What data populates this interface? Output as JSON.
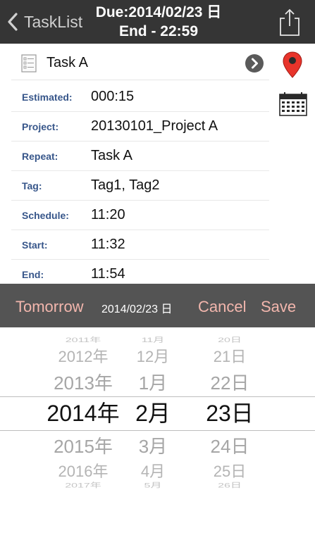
{
  "navbar": {
    "back_label": "TaskList",
    "title_line1": "Due:2014/02/23 日",
    "title_line2": "End - 22:59"
  },
  "task": {
    "name": "Task A"
  },
  "fields": [
    {
      "label": "Estimated:",
      "value": "000:15"
    },
    {
      "label": "Project:",
      "value": "20130101_Project A"
    },
    {
      "label": "Repeat:",
      "value": "Task A"
    },
    {
      "label": "Tag:",
      "value": "Tag1, Tag2"
    },
    {
      "label": "Schedule:",
      "value": "11:20"
    },
    {
      "label": "Start:",
      "value": "11:32"
    },
    {
      "label": "End:",
      "value": "11:54"
    }
  ],
  "toolbar": {
    "tomorrow_label": "Tomorrow",
    "date_label": "2014/02/23 日",
    "cancel_label": "Cancel",
    "save_label": "Save"
  },
  "picker": {
    "years": [
      "2011年",
      "2012年",
      "2013年",
      "2014年",
      "2015年",
      "2016年",
      "2017年"
    ],
    "months": [
      "11月",
      "12月",
      "1月",
      "2月",
      "3月",
      "4月",
      "5月"
    ],
    "days": [
      "20日",
      "21日",
      "22日",
      "23日",
      "24日",
      "25日",
      "26日"
    ],
    "selected": {
      "year": "2014年",
      "month": "2月",
      "day": "23日"
    }
  },
  "colors": {
    "navbar_bg": "#353535",
    "toolbar_bg": "#545454",
    "toolbar_button": "#f2b6ad",
    "field_label": "#37568a",
    "pin_red": "#e8342b"
  },
  "icons": [
    "back-chevron-icon",
    "share-icon",
    "checklist-icon",
    "chevron-right-circle-icon",
    "map-pin-icon",
    "calendar-icon"
  ]
}
